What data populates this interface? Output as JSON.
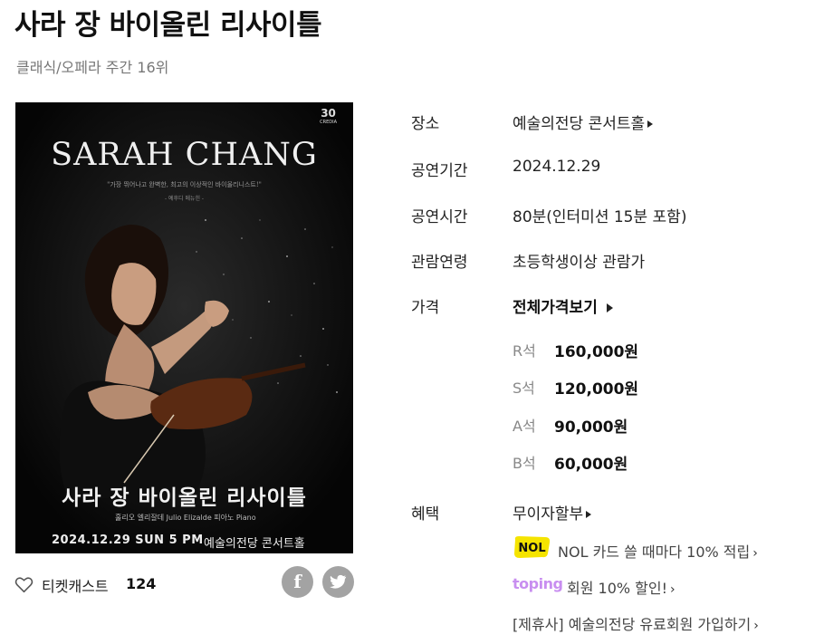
{
  "header": {
    "title": "사라 장 바이올린 리사이틀",
    "ranking": "클래식/오페라 주간 16위"
  },
  "poster": {
    "name": "SARAH CHANG",
    "quote": "\"가장 뛰어나고 완벽한, 최고의 이상적인 바이올리니스트!\"",
    "quote_source": "- 예후디 메뉴힌 -",
    "logo_number": "30",
    "logo_text": "CREDIA",
    "korean_title": "사라 장 바이올린 리사이틀",
    "performers": "훌리오 엘리잘데 Julio Elizalde 피아노 Piano",
    "date_time": "2024.12.29 SUN  5 PM",
    "venue": "예술의전당 콘서트홀"
  },
  "social": {
    "cast_label": "티켓캐스트",
    "cast_count": "124"
  },
  "info": [
    {
      "label": "장소",
      "value": "예술의전당 콘서트홀"
    },
    {
      "label": "공연기간",
      "value": "2024.12.29"
    },
    {
      "label": "공연시간",
      "value": "80분(인터미션 15분 포함)"
    },
    {
      "label": "관람연령",
      "value": "초등학생이상 관람가"
    },
    {
      "label": "가격",
      "value": "전체가격보기"
    }
  ],
  "prices": [
    {
      "seat": "R석",
      "price": "160,000원"
    },
    {
      "seat": "S석",
      "price": "120,000원"
    },
    {
      "seat": "A석",
      "price": "90,000원"
    },
    {
      "seat": "B석",
      "price": "60,000원"
    }
  ],
  "benefits": {
    "label": "혜택",
    "interest_free": "무이자할부",
    "nol_badge": "NOL",
    "nol_text": "NOL 카드 쓸 때마다 10% 적립",
    "toping_badge": "toping",
    "toping_text": "회원 10% 할인!",
    "partner_text": "[제휴사] 예술의전당 유료회원 가입하기"
  },
  "colors": {
    "nol_yellow": "#f5e400",
    "toping_purple": "#c88ef0",
    "share_gray": "#a3a3a3"
  },
  "icons": [
    "heart-icon",
    "facebook-icon",
    "twitter-icon",
    "chevron-right-icon"
  ]
}
